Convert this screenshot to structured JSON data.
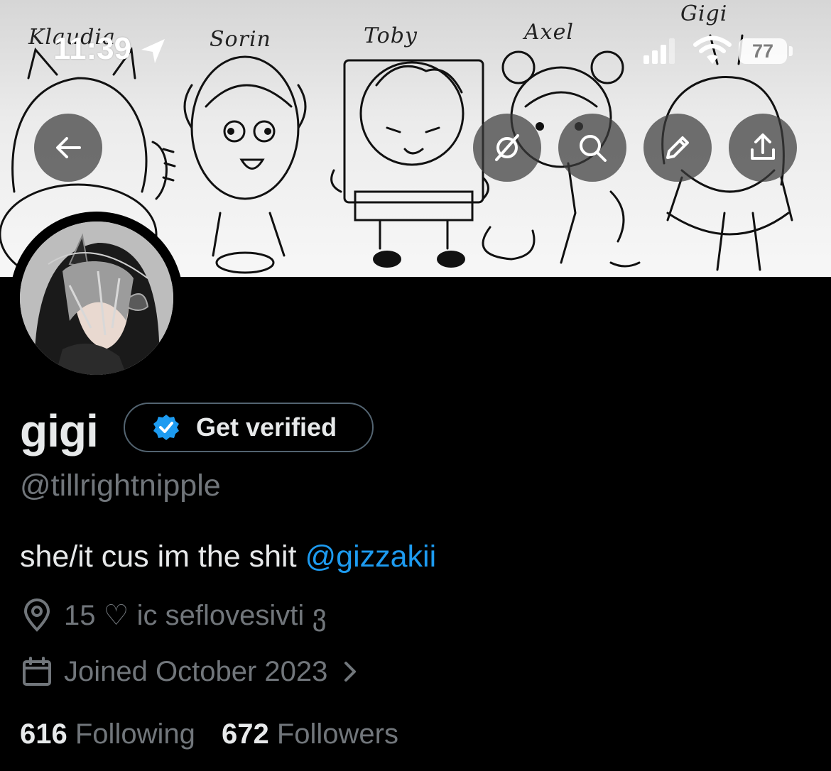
{
  "status_bar": {
    "time": "11:39",
    "battery": "77"
  },
  "banner": {
    "characters": [
      "Klaudia",
      "Sorin",
      "Toby",
      "Axel",
      "Gigi"
    ]
  },
  "icons": {
    "back": "arrow-left-icon",
    "grok": "grok-icon",
    "search": "search-icon",
    "edit": "pencil-icon",
    "share": "share-icon",
    "verified": "verified-badge-icon",
    "location": "location-pin-icon",
    "calendar": "calendar-icon",
    "chevron": "chevron-right-icon"
  },
  "profile": {
    "display_name": "gigi",
    "get_verified_label": "Get verified",
    "handle": "@tillrightnipple",
    "bio_text": "she/it cus im the shit ",
    "bio_mention": "@gizzakii",
    "location": "15 ♡ ic seflovesivti ვ",
    "joined": "Joined October 2023",
    "following_count": "616",
    "following_label": "Following",
    "followers_count": "672",
    "followers_label": "Followers"
  },
  "colors": {
    "background": "#000000",
    "accent": "#1d9bf0",
    "secondary_text": "#71767b",
    "primary_text": "#e7e9ea"
  }
}
